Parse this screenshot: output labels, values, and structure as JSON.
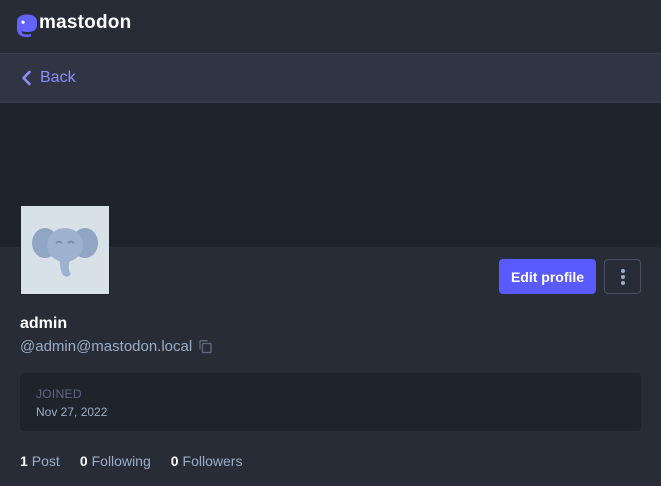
{
  "app": {
    "name": "mastodon"
  },
  "nav": {
    "back_label": "Back"
  },
  "profile": {
    "display_name": "admin",
    "acct": "@admin@mastodon.local",
    "edit_label": "Edit profile",
    "joined_label": "JOINED",
    "joined_date": "Nov 27, 2022"
  },
  "stats": {
    "posts": {
      "count": "1",
      "label": "Post"
    },
    "following": {
      "count": "0",
      "label": "Following"
    },
    "followers": {
      "count": "0",
      "label": "Followers"
    }
  },
  "colors": {
    "accent": "#595aff",
    "link": "#8c8dff",
    "background": "#282c37",
    "panel": "#1f232b"
  }
}
